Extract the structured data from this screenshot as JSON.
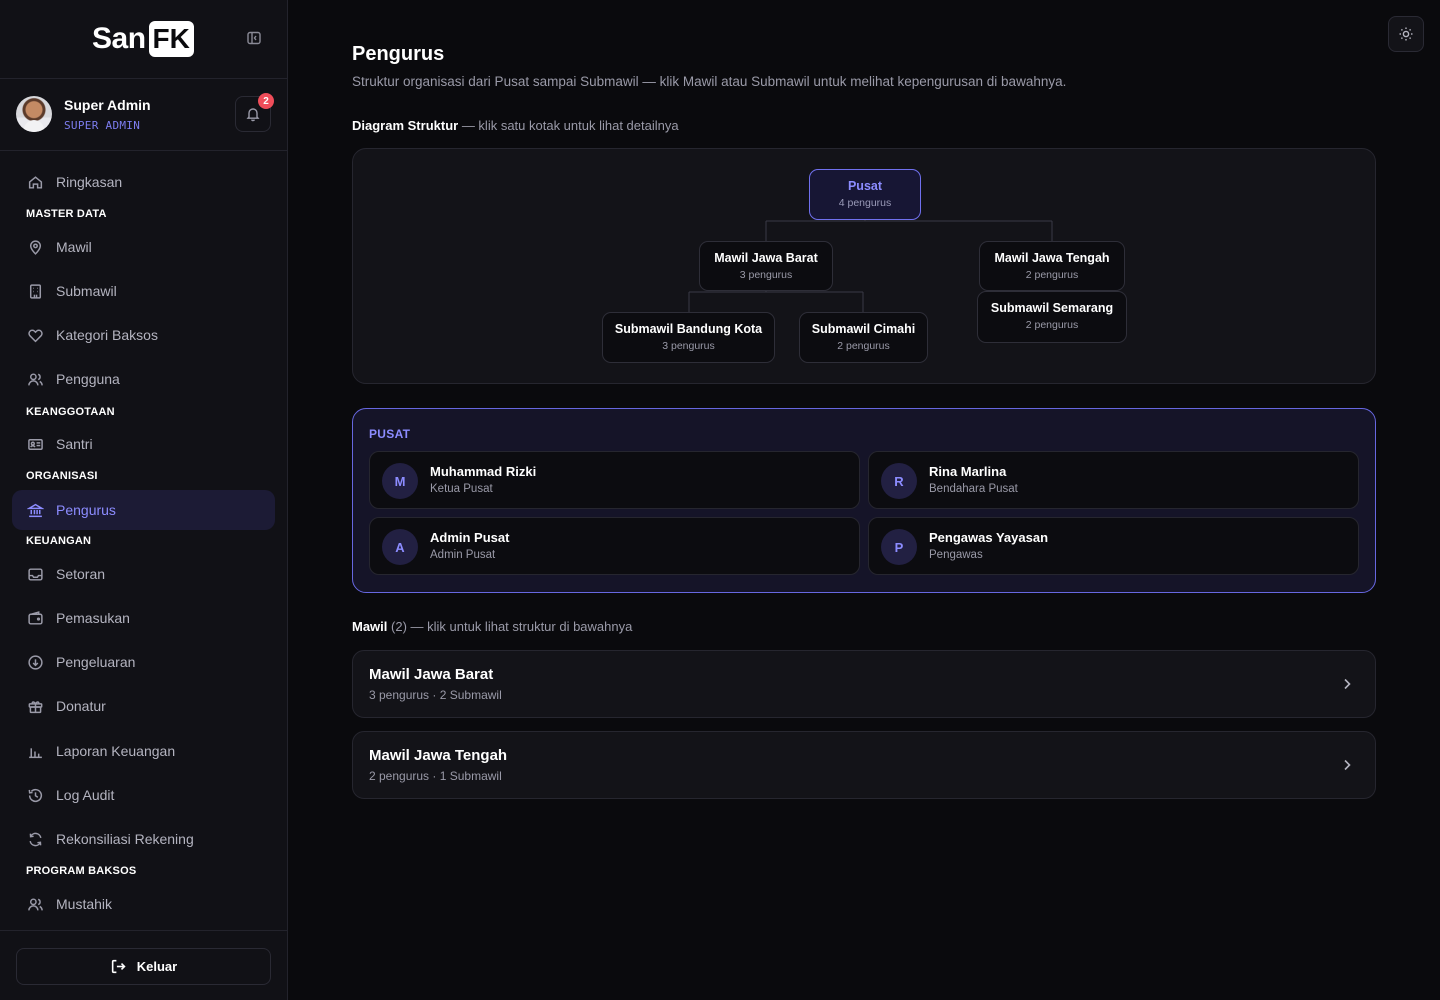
{
  "brand": {
    "name_part1": "San",
    "name_part2": "FK"
  },
  "profile": {
    "name": "Super Admin",
    "role": "SUPER ADMIN",
    "notifications": "2"
  },
  "sidebar": {
    "items": [
      {
        "label": "Ringkasan",
        "icon": "home-icon"
      },
      {
        "section": "MASTER DATA"
      },
      {
        "label": "Mawil",
        "icon": "map-pin-icon"
      },
      {
        "label": "Submawil",
        "icon": "building-icon"
      },
      {
        "label": "Kategori Baksos",
        "icon": "heart-icon"
      },
      {
        "label": "Pengguna",
        "icon": "users-icon"
      },
      {
        "section": "KEANGGOTAAN"
      },
      {
        "label": "Santri",
        "icon": "id-card-icon"
      },
      {
        "section": "ORGANISASI"
      },
      {
        "label": "Pengurus",
        "icon": "landmark-icon",
        "active": true
      },
      {
        "section": "KEUANGAN"
      },
      {
        "label": "Setoran",
        "icon": "inbox-icon"
      },
      {
        "label": "Pemasukan",
        "icon": "wallet-icon"
      },
      {
        "label": "Pengeluaran",
        "icon": "arrow-down-circle-icon"
      },
      {
        "label": "Donatur",
        "icon": "gift-icon"
      },
      {
        "label": "Laporan Keuangan",
        "icon": "bar-chart-icon"
      },
      {
        "label": "Log Audit",
        "icon": "history-icon"
      },
      {
        "label": "Rekonsiliasi Rekening",
        "icon": "refresh-icon"
      },
      {
        "section": "PROGRAM BAKSOS"
      },
      {
        "label": "Mustahik",
        "icon": "users-icon"
      }
    ],
    "logout_label": "Keluar"
  },
  "page": {
    "title": "Pengurus",
    "subtitle": "Struktur organisasi dari Pusat sampai Submawil — klik Mawil atau Submawil untuk melihat kepengurusan di bawahnya."
  },
  "diagram": {
    "label_bold": "Diagram Struktur",
    "label_rest": " — klik satu kotak untuk lihat detailnya",
    "nodes": {
      "pusat": {
        "title": "Pusat",
        "count": "4 pengurus"
      },
      "jabar": {
        "title": "Mawil Jawa Barat",
        "count": "3 pengurus"
      },
      "jateng": {
        "title": "Mawil Jawa Tengah",
        "count": "2 pengurus"
      },
      "bandung": {
        "title": "Submawil Bandung Kota",
        "count": "3 pengurus"
      },
      "cimahi": {
        "title": "Submawil Cimahi",
        "count": "2 pengurus"
      },
      "semarang": {
        "title": "Submawil Semarang",
        "count": "2 pengurus"
      }
    }
  },
  "pusat": {
    "label": "PUSAT",
    "members": [
      {
        "initial": "M",
        "name": "Muhammad Rizki",
        "role": "Ketua Pusat"
      },
      {
        "initial": "R",
        "name": "Rina Marlina",
        "role": "Bendahara Pusat"
      },
      {
        "initial": "A",
        "name": "Admin Pusat",
        "role": "Admin Pusat"
      },
      {
        "initial": "P",
        "name": "Pengawas Yayasan",
        "role": "Pengawas"
      }
    ]
  },
  "mawil": {
    "label_bold": "Mawil",
    "label_count": " (2)",
    "label_rest": " — klik untuk lihat struktur di bawahnya",
    "items": [
      {
        "title": "Mawil Jawa Barat",
        "meta": "3 pengurus · 2 Submawil"
      },
      {
        "title": "Mawil Jawa Tengah",
        "meta": "2 pengurus · 1 Submawil"
      }
    ]
  },
  "colors": {
    "accent": "#8c8cff",
    "background": "#0a0a0d",
    "badge": "#f04d5a"
  }
}
